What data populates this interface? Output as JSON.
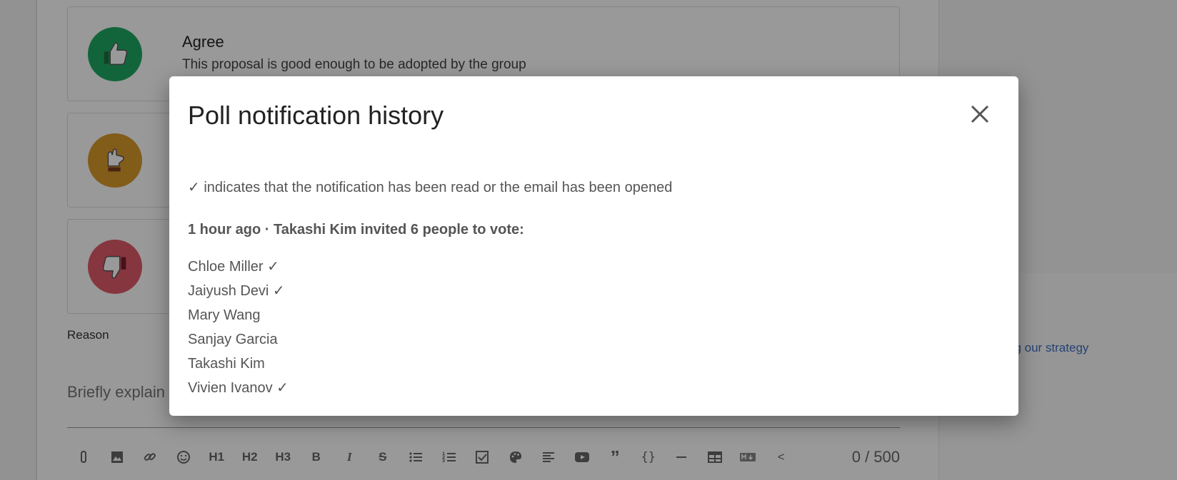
{
  "background": {
    "options": [
      {
        "icon": "thumbs-up-icon",
        "color": "#1fa863",
        "title": "Agree",
        "description": "This proposal is good enough to be adopted by the group"
      },
      {
        "icon": "thumb-sideways-icon",
        "color": "#d99a2b",
        "title": "",
        "description": ""
      },
      {
        "icon": "thumbs-down-icon",
        "color": "#e05b6a",
        "title": "",
        "description": ""
      }
    ],
    "reason_label": "Reason",
    "reason_placeholder": "Briefly explain",
    "counter": "0 / 500",
    "right_link": "ng our strategy",
    "toolbar": [
      {
        "icon": "attach-icon",
        "glyph": ""
      },
      {
        "icon": "image-icon",
        "glyph": ""
      },
      {
        "icon": "link-icon",
        "glyph": ""
      },
      {
        "icon": "emoji-icon",
        "glyph": ""
      },
      {
        "icon": "heading1-icon",
        "glyph": "H1"
      },
      {
        "icon": "heading2-icon",
        "glyph": "H2"
      },
      {
        "icon": "heading3-icon",
        "glyph": "H3"
      },
      {
        "icon": "bold-icon",
        "glyph": "B"
      },
      {
        "icon": "italic-icon",
        "glyph": "I"
      },
      {
        "icon": "strikethrough-icon",
        "glyph": "S"
      },
      {
        "icon": "bullet-list-icon",
        "glyph": ""
      },
      {
        "icon": "numbered-list-icon",
        "glyph": ""
      },
      {
        "icon": "checkbox-icon",
        "glyph": ""
      },
      {
        "icon": "palette-icon",
        "glyph": ""
      },
      {
        "icon": "align-icon",
        "glyph": ""
      },
      {
        "icon": "video-icon",
        "glyph": ""
      },
      {
        "icon": "quote-icon",
        "glyph": "”"
      },
      {
        "icon": "code-icon",
        "glyph": "{}"
      },
      {
        "icon": "horizontal-rule-icon",
        "glyph": ""
      },
      {
        "icon": "table-icon",
        "glyph": ""
      },
      {
        "icon": "markdown-icon",
        "glyph": ""
      },
      {
        "icon": "collapse-icon",
        "glyph": "<"
      }
    ]
  },
  "dialog": {
    "title": "Poll notification history",
    "close_icon": "close-icon",
    "help_text": "✓ indicates that the notification has been read or the email has been opened",
    "event_heading": "1 hour ago · Takashi Kim invited 6 people to vote:",
    "recipients": [
      "Chloe Miller ✓",
      "Jaiyush Devi ✓",
      "Mary Wang",
      "Sanjay Garcia",
      "Takashi Kim",
      "Vivien Ivanov ✓"
    ]
  }
}
